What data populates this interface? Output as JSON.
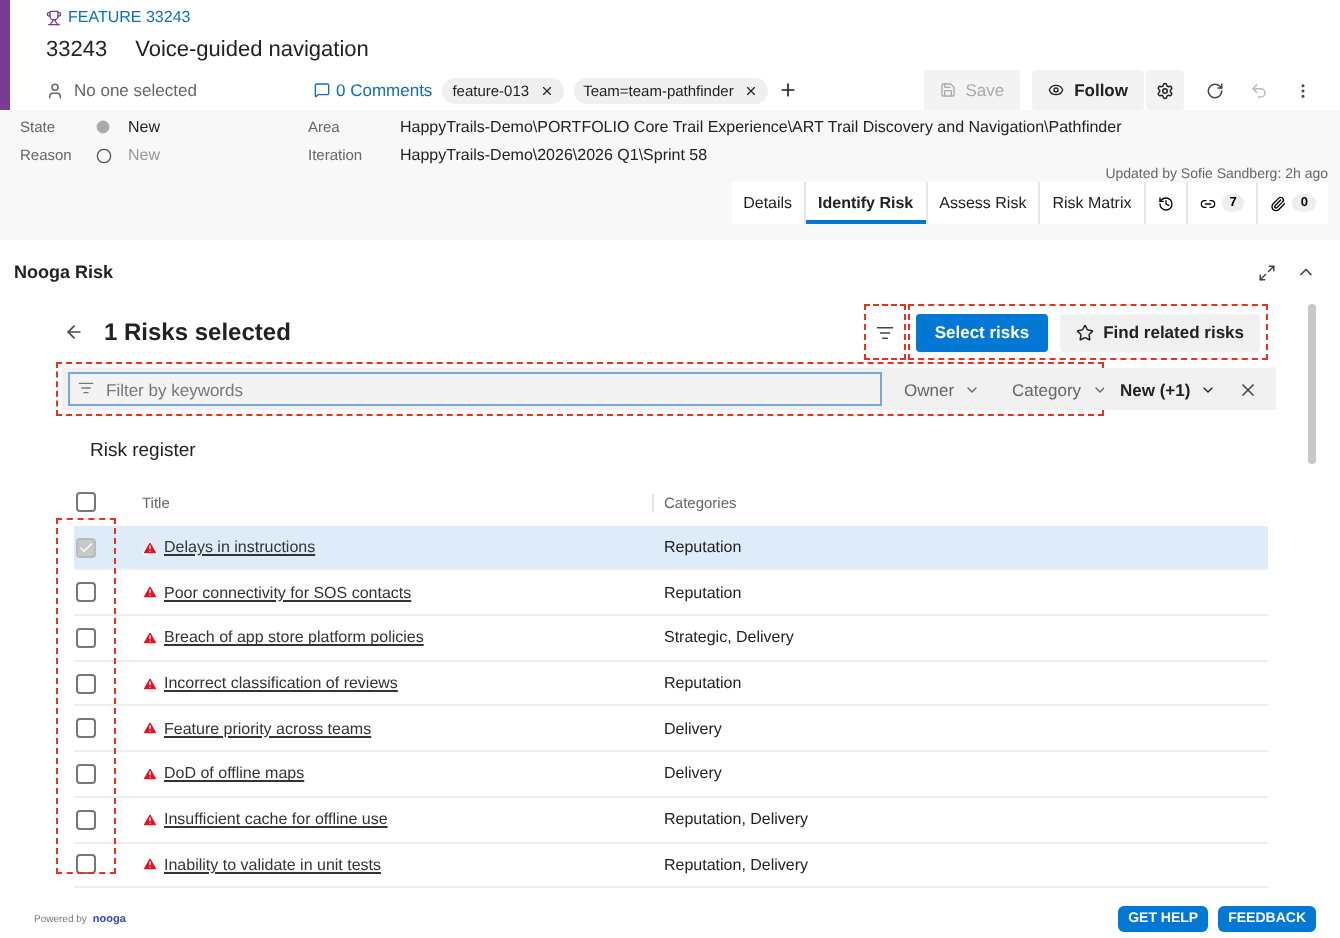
{
  "work_item": {
    "type_label": "FEATURE 33243",
    "id": "33243",
    "title": "Voice-guided navigation"
  },
  "assignee": "No one selected",
  "comments": "0 Comments",
  "tags": [
    {
      "label": "feature-013"
    },
    {
      "label": "Team=team-pathfinder"
    }
  ],
  "toolbar": {
    "save": "Save",
    "save_disabled": true,
    "follow": "Follow"
  },
  "fields": [
    {
      "label": "State",
      "value": "New",
      "kind": "state"
    },
    {
      "label": "Reason",
      "value": "New",
      "kind": "reason"
    }
  ],
  "paths": [
    {
      "label": "Area",
      "value": "HappyTrails-Demo\\PORTFOLIO Core Trail Experience\\ART Trail Discovery and Navigation\\Pathfinder"
    },
    {
      "label": "Iteration",
      "value": "HappyTrails-Demo\\2026\\2026 Q1\\Sprint 58"
    }
  ],
  "updated": "Updated by Sofie Sandberg: 2h ago",
  "tabs": [
    {
      "label": "Details",
      "selected": false
    },
    {
      "label": "Identify Risk",
      "selected": true
    },
    {
      "label": "Assess Risk",
      "selected": false
    },
    {
      "label": "Risk Matrix",
      "selected": false
    }
  ],
  "links_count": "7",
  "attachments_count": "0",
  "panel": {
    "title": "Nooga Risk",
    "heading": "1 Risks selected",
    "filter_highlighted": true,
    "actions_highlighted": true,
    "select_button": "Select risks",
    "find_button": "Find related risks",
    "search": {
      "placeholder": "Filter by keywords"
    },
    "filters_highlighted": true,
    "dropdowns": [
      {
        "label": "Owner",
        "active": false
      },
      {
        "label": "Category",
        "active": false
      },
      {
        "label": "New (+1)",
        "active": true
      }
    ]
  },
  "register": {
    "title": "Risk register",
    "columns": [
      "Title",
      "Categories"
    ],
    "all_checked": false,
    "checkbox_column_highlighted": true,
    "rows": [
      {
        "title": "Delays in instructions",
        "categories": "Reputation",
        "selected": true
      },
      {
        "title": "Poor connectivity for SOS contacts",
        "categories": "Reputation",
        "selected": false
      },
      {
        "title": "Breach of app store platform policies",
        "categories": "Strategic, Delivery",
        "selected": false
      },
      {
        "title": "Incorrect classification of reviews",
        "categories": "Reputation",
        "selected": false
      },
      {
        "title": "Feature priority across teams",
        "categories": "Delivery",
        "selected": false
      },
      {
        "title": "DoD of offline maps",
        "categories": "Delivery",
        "selected": false
      },
      {
        "title": "Insufficient cache for offline use",
        "categories": "Reputation, Delivery",
        "selected": false
      },
      {
        "title": "Inability to validate in unit tests",
        "categories": "Reputation, Delivery",
        "selected": false
      }
    ]
  },
  "footer": {
    "powered": "Powered by",
    "brand": "nooga",
    "buttons": [
      "GET HELP",
      "FEEDBACK"
    ]
  }
}
